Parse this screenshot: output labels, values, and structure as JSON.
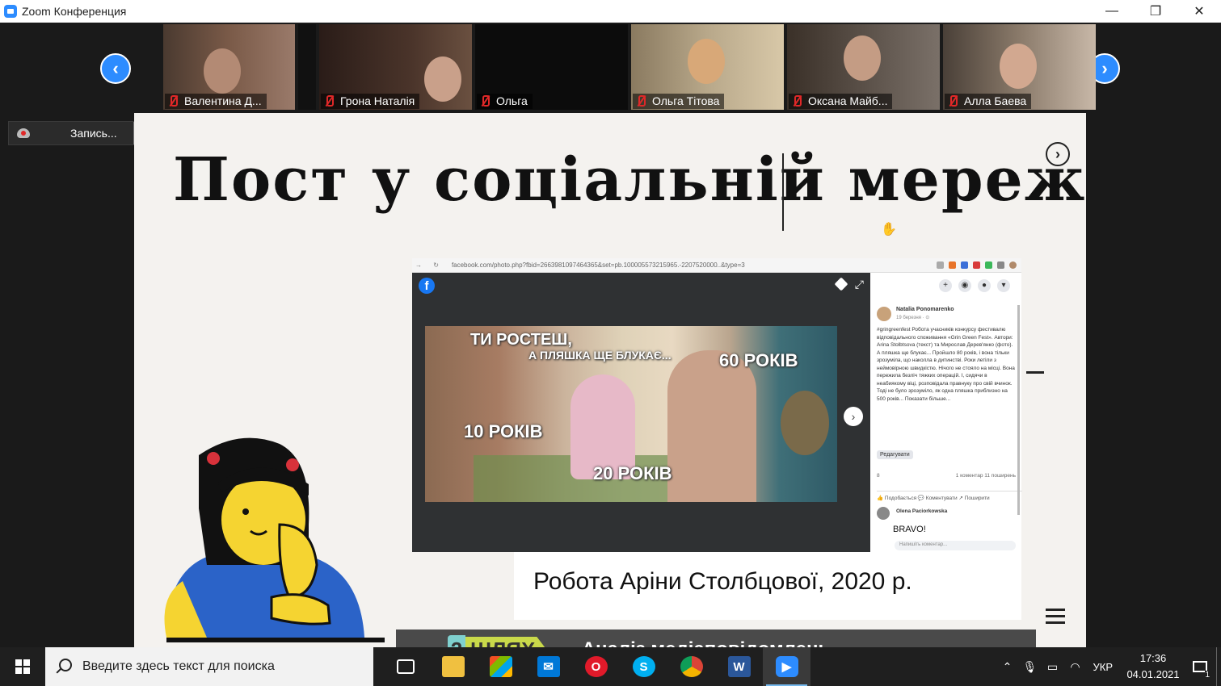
{
  "window": {
    "title": "Zoom Конференция",
    "controls": [
      "—",
      "❐",
      "✕"
    ]
  },
  "participants": [
    {
      "name": "Валентина Д...",
      "muted": true
    },
    {
      "name": "Грона Наталія",
      "muted": true
    },
    {
      "name": "Ольга",
      "muted": true
    },
    {
      "name": "Ольга Тітова",
      "muted": true
    },
    {
      "name": "Оксана Майб...",
      "muted": true
    },
    {
      "name": "Алла Баева",
      "muted": true
    }
  ],
  "recording": {
    "label": "Запись..."
  },
  "slide": {
    "title": "Пост у соціальній мережі",
    "caption": "Робота Аріни Столбцової, 2020 р.",
    "footer_heading": "Аналіз медіаповідомлень",
    "footer_badge_number": "2",
    "footer_badge_word": "ШЛЯХ",
    "footer_dashes": "------",
    "footer_dashes_right": "--------------"
  },
  "facebook": {
    "url": "facebook.com/photo.php?fbid=2663981097464365&set=pb.100005573215965.-2207520000..&type=3",
    "author": "Natalia Ponomarenko",
    "date": "19 березня · ⊙",
    "post_text": "#gringreenfest Робота учасників конкурсу фестивалю відповідального споживання «Grin Green Fest». Автори: Arina Stolbtsova (текст) та Мирослав Дерев'янко (фото). А пляшка ще блукає... Пройшло 80 років, і вона тільки зрозуміла, що наколла в дитинстві. Роки летіли з неймовірною швидкістю. Нічого не стояло на місці. Вона пережила безліч тяжких операцій. І, сидячи в неабиякому віці, розповідала правнуку про свій вчинок. Тоді не було зрозуміло, як одна пляшка приблизно на 500 років... Показати більше...",
    "edit_label": "Редагувати",
    "reactions": "8",
    "comments_shares": "1 коментар  11 поширень",
    "actions": "👍 Подобається  💬 Коментувати  ↗ Поширити",
    "commenter": "Olena Paciorkowska",
    "comment": "BRAVO!",
    "write_comment": "Напишіть коментар...",
    "photo_texts": {
      "line1": "ТИ РОСТЕШ,",
      "line2": "А ПЛЯШКА ЩЕ БЛУКАЄ...",
      "age60": "60 РОКІВ",
      "age10": "10 РОКІВ",
      "age20": "20 РОКІВ"
    }
  },
  "taskbar": {
    "search_placeholder": "Введите здесь текст для поиска",
    "language": "УКР",
    "time": "17:36",
    "date": "04.01.2021",
    "notifications": "1",
    "apps": [
      "task-view",
      "file-explorer",
      "store",
      "mail",
      "opera",
      "skype",
      "chrome",
      "word",
      "zoom"
    ]
  },
  "colors": {
    "zoom_blue": "#2d8cff",
    "muted_red": "#e02828",
    "slide_bg": "#f4f2ef",
    "bar_bg": "#4a4a4a"
  }
}
